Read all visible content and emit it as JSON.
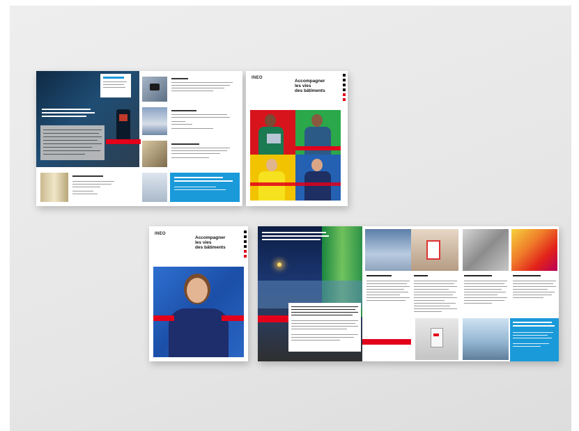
{
  "brand": {
    "logo_text": "INEO"
  },
  "cover": {
    "title_line1": "Accompagner",
    "title_line2": "les vies",
    "title_line3": "des bâtiments"
  },
  "colors": {
    "red": "#e2001a",
    "blue": "#1a9ad9",
    "navy": "#1d3557"
  },
  "icons": [
    "person-photo",
    "building-photo",
    "hospital-photo"
  ]
}
